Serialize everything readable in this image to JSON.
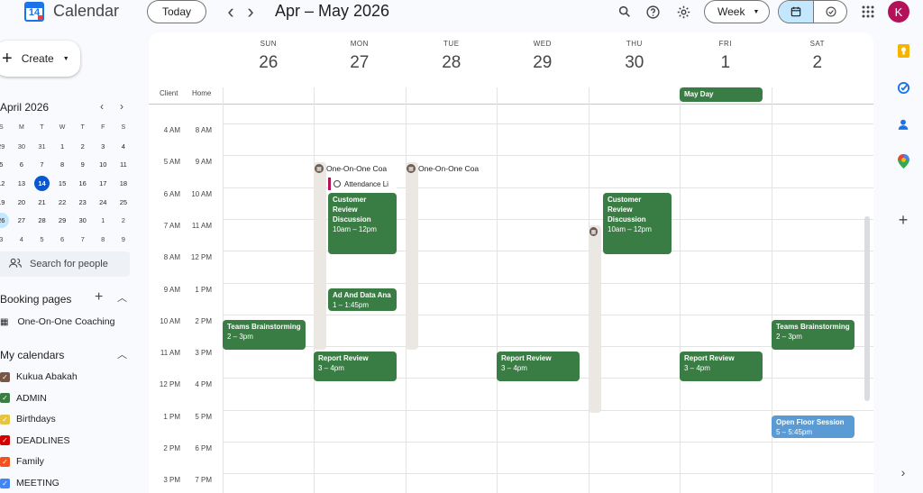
{
  "header": {
    "logo_day": "14",
    "app_title": "Calendar",
    "today_label": "Today",
    "prev_icon": "‹",
    "next_icon": "›",
    "date_range": "Apr – May 2026",
    "view_label": "Week",
    "avatar_letter": "K"
  },
  "sidebar": {
    "create_label": "Create",
    "mini_cal": {
      "title": "April 2026",
      "dow": [
        "S",
        "M",
        "T",
        "W",
        "T",
        "F",
        "S"
      ],
      "weeks": [
        [
          "29",
          "30",
          "31",
          "1",
          "2",
          "3",
          "4"
        ],
        [
          "5",
          "6",
          "7",
          "8",
          "9",
          "10",
          "11"
        ],
        [
          "12",
          "13",
          "14",
          "15",
          "16",
          "17",
          "18"
        ],
        [
          "19",
          "20",
          "21",
          "22",
          "23",
          "24",
          "25"
        ],
        [
          "26",
          "27",
          "28",
          "29",
          "30",
          "1",
          "2"
        ],
        [
          "3",
          "4",
          "5",
          "6",
          "7",
          "8",
          "9"
        ]
      ]
    },
    "search_people": "Search for people",
    "booking_title": "Booking pages",
    "booking_item": "One-On-One Coaching",
    "my_cal_title": "My calendars",
    "calendars": [
      {
        "name": "Kukua Abakah",
        "color": "#795548"
      },
      {
        "name": "ADMIN",
        "color": "#3a7d44"
      },
      {
        "name": "Birthdays",
        "color": "#e4c441"
      },
      {
        "name": "DEADLINES",
        "color": "#d50000"
      },
      {
        "name": "Family",
        "color": "#f4511e"
      },
      {
        "name": "MEETING",
        "color": "#4285f4"
      }
    ]
  },
  "week": {
    "days": [
      {
        "dow": "SUN",
        "num": "26"
      },
      {
        "dow": "MON",
        "num": "27"
      },
      {
        "dow": "TUE",
        "num": "28"
      },
      {
        "dow": "WED",
        "num": "29"
      },
      {
        "dow": "THU",
        "num": "30"
      },
      {
        "dow": "FRI",
        "num": "1"
      },
      {
        "dow": "SAT",
        "num": "2"
      }
    ],
    "tz1": "Client",
    "tz2": "Home",
    "times": [
      [
        "4 AM",
        "8 AM"
      ],
      [
        "5 AM",
        "9 AM"
      ],
      [
        "6 AM",
        "10 AM"
      ],
      [
        "7 AM",
        "11 AM"
      ],
      [
        "8 AM",
        "12 PM"
      ],
      [
        "9 AM",
        "1 PM"
      ],
      [
        "10 AM",
        "2 PM"
      ],
      [
        "11 AM",
        "3 PM"
      ],
      [
        "12 PM",
        "4 PM"
      ],
      [
        "1 PM",
        "5 PM"
      ],
      [
        "2 PM",
        "6 PM"
      ],
      [
        "3 PM",
        "7 PM"
      ]
    ]
  },
  "events": {
    "may_day": "May Day",
    "booking_mon": "One-On-One Coa",
    "booking_tue": "One-On-One Coa",
    "attendance": "Attendance Li",
    "review_mon": {
      "title": "Customer Review Discussion",
      "time": "10am – 12pm"
    },
    "review_thu": {
      "title": "Customer Review Discussion",
      "time": "10am – 12pm"
    },
    "ad_data": {
      "title": "Ad And Data Ana",
      "time": "1 – 1:45pm"
    },
    "teams_sun": {
      "title": "Teams Brainstorming",
      "time": "2 – 3pm"
    },
    "teams_sat": {
      "title": "Teams Brainstorming",
      "time": "2 – 3pm"
    },
    "report_mon": {
      "title": "Report Review",
      "time": "3 – 4pm"
    },
    "report_wed": {
      "title": "Report Review",
      "time": "3 – 4pm"
    },
    "report_fri": {
      "title": "Report Review",
      "time": "3 – 4pm"
    },
    "open_floor": {
      "title": "Open Floor Session",
      "time": "5 – 5:45pm"
    }
  }
}
